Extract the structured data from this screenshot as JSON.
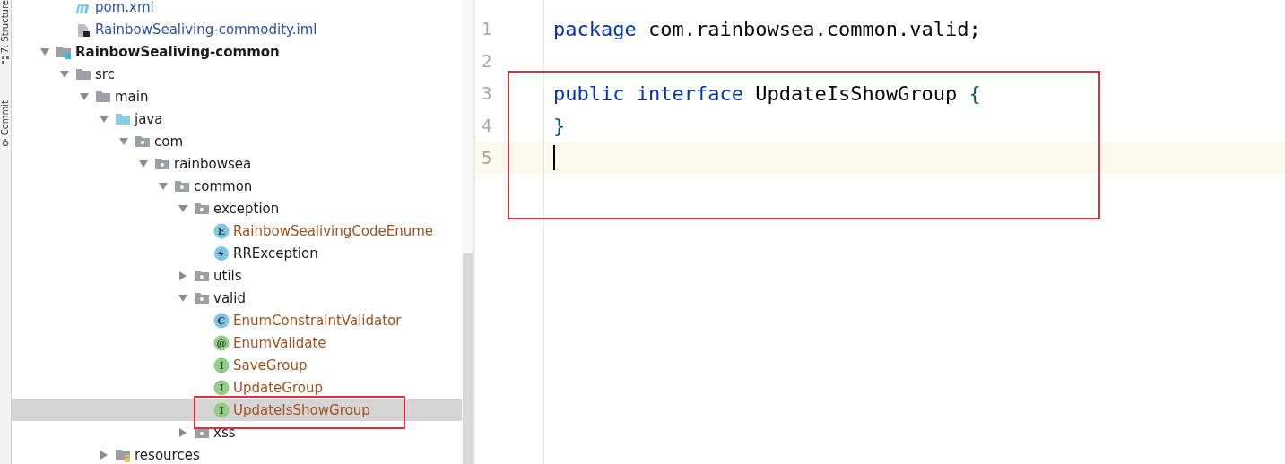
{
  "tool_strip": [
    {
      "label": "7: Structure",
      "kind": "structure"
    },
    {
      "label": "Commit",
      "kind": "commit"
    }
  ],
  "tree": [
    {
      "children": [
        {
          "label": "pom.xml",
          "kind": "maven",
          "color": "#2a4fa8"
        },
        {
          "label": "RainbowSealiving-commodity.iml",
          "kind": "iml",
          "color": "#2a4fa8"
        }
      ]
    },
    {
      "label": "RainbowSealiving-common",
      "kind": "module",
      "bold": true,
      "expanded": true,
      "children": [
        {
          "label": "src",
          "kind": "folder",
          "expanded": true,
          "children": [
            {
              "label": "main",
              "kind": "folder",
              "expanded": true,
              "children": [
                {
                  "label": "java",
                  "kind": "source",
                  "expanded": true,
                  "children": [
                    {
                      "label": "com",
                      "kind": "package",
                      "expanded": true,
                      "children": [
                        {
                          "label": "rainbowsea",
                          "kind": "package",
                          "expanded": true,
                          "children": [
                            {
                              "label": "common",
                              "kind": "package",
                              "expanded": true,
                              "children": [
                                {
                                  "label": "exception",
                                  "kind": "package",
                                  "expanded": true,
                                  "children": [
                                    {
                                      "label": "RainbowSealivingCodeEnume",
                                      "kind": "enum",
                                      "badge": "E",
                                      "color": "#a0501c"
                                    },
                                    {
                                      "label": "RRException",
                                      "kind": "exception",
                                      "color": "#1a1a1a"
                                    }
                                  ]
                                },
                                {
                                  "label": "utils",
                                  "kind": "package",
                                  "expanded": false
                                },
                                {
                                  "label": "valid",
                                  "kind": "package",
                                  "expanded": true,
                                  "children": [
                                    {
                                      "label": "EnumConstraintValidator",
                                      "kind": "class",
                                      "badge": "C",
                                      "color": "#a0501c"
                                    },
                                    {
                                      "label": "EnumValidate",
                                      "kind": "annotation",
                                      "badge": "@",
                                      "color": "#a0501c"
                                    },
                                    {
                                      "label": "SaveGroup",
                                      "kind": "interface",
                                      "badge": "I",
                                      "color": "#a0501c"
                                    },
                                    {
                                      "label": "UpdateGroup",
                                      "kind": "interface",
                                      "badge": "I",
                                      "color": "#a0501c"
                                    },
                                    {
                                      "label": "UpdateIsShowGroup",
                                      "kind": "interface",
                                      "badge": "I",
                                      "color": "#a0501c",
                                      "selected": true,
                                      "annotated": true
                                    }
                                  ]
                                },
                                {
                                  "label": "xss",
                                  "kind": "package",
                                  "expanded": false
                                }
                              ]
                            }
                          ]
                        }
                      ]
                    }
                  ]
                },
                {
                  "label": "resources",
                  "kind": "resources",
                  "expanded": false
                }
              ]
            }
          ]
        }
      ]
    }
  ],
  "editor": {
    "annotated": true,
    "lines": [
      {
        "number": "1",
        "tokens": [
          {
            "kind": "keyword",
            "text": "package"
          },
          {
            "kind": "plain",
            "text": " com.rainbowsea.common.valid;"
          }
        ]
      },
      {
        "number": "2"
      },
      {
        "number": "3",
        "tokens": [
          {
            "kind": "keyword",
            "text": "public"
          },
          {
            "kind": "keyword",
            "text": " interface"
          },
          {
            "kind": "plain",
            "text": " UpdateIsShowGroup "
          },
          {
            "kind": "brace",
            "text": "{"
          }
        ]
      },
      {
        "number": "4",
        "tokens": [
          {
            "kind": "brace",
            "text": "}"
          }
        ]
      },
      {
        "number": "5",
        "current": true,
        "caret": true
      }
    ]
  }
}
